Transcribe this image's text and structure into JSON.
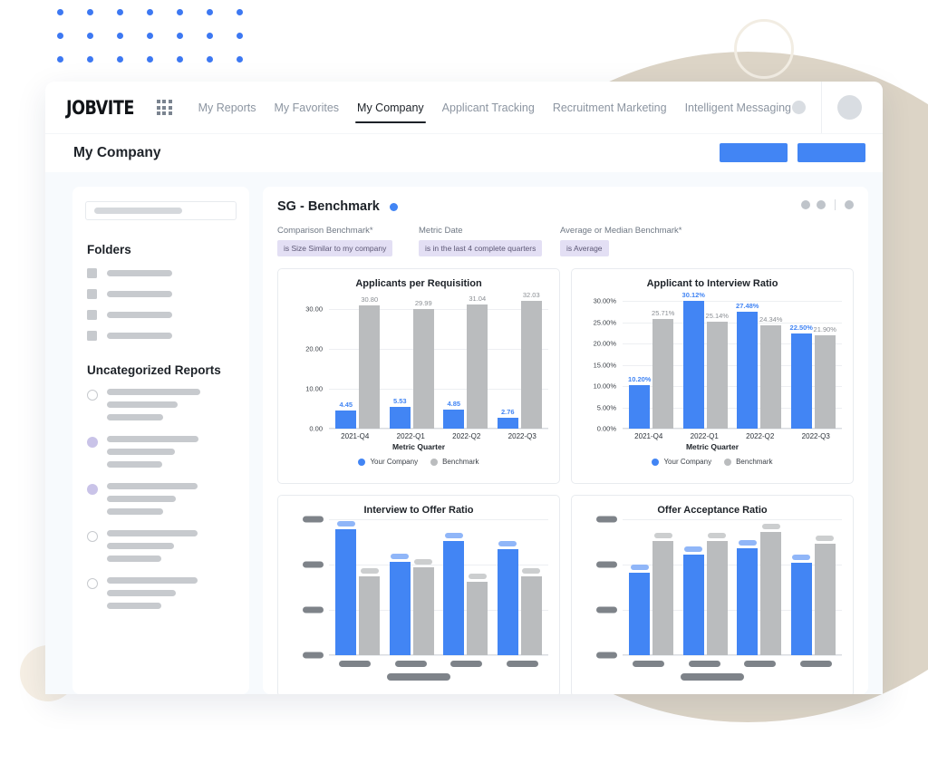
{
  "nav": {
    "logo": "JOBVITE",
    "grid_icon": "apps-grid-icon",
    "links": [
      {
        "label": "My Reports",
        "active": false
      },
      {
        "label": "My Favorites",
        "active": false
      },
      {
        "label": "My Company",
        "active": true
      },
      {
        "label": "Applicant Tracking",
        "active": false
      },
      {
        "label": "Recruitment Marketing",
        "active": false
      },
      {
        "label": "Intelligent Messaging",
        "active": false
      }
    ]
  },
  "page_header": {
    "title": "My Company",
    "buttons": [
      "",
      ""
    ]
  },
  "sidebar": {
    "search_placeholder": "",
    "folders_title": "Folders",
    "folder_widths": [
      72,
      72,
      72,
      72
    ],
    "reports_title": "Uncategorized Reports",
    "reports": [
      {
        "state": "empty",
        "lines": [
          103,
          78,
          62
        ]
      },
      {
        "state": "filled",
        "lines": [
          101,
          75,
          61
        ]
      },
      {
        "state": "filled",
        "lines": [
          100,
          76,
          62
        ]
      },
      {
        "state": "empty",
        "lines": [
          100,
          74,
          60
        ]
      },
      {
        "state": "empty",
        "lines": [
          100,
          76,
          60
        ]
      }
    ]
  },
  "report": {
    "title": "SG - Benchmark",
    "status_dot_color": "#4285F4",
    "controls": [
      "dot",
      "dot",
      "divider",
      "dot"
    ],
    "filters": [
      {
        "label": "Comparison Benchmark*",
        "value": "is Size Similar to my company"
      },
      {
        "label": "Metric Date",
        "value": "is in the last 4 complete quarters"
      },
      {
        "label": "Average or Median Benchmark*",
        "value": "is Average"
      }
    ]
  },
  "legend": {
    "series_1": "Your Company",
    "series_2": "Benchmark"
  },
  "colors": {
    "blue": "#4285F4",
    "gray": "#BABCBE",
    "accent_violet": "#C9C3E8",
    "skeleton": "#C7CACE"
  },
  "chart_data": [
    {
      "type": "bar",
      "title": "Applicants per Requisition",
      "xlabel": "Metric Quarter",
      "ylabel": "",
      "categories": [
        "2021-Q4",
        "2022-Q1",
        "2022-Q2",
        "2022-Q3"
      ],
      "yticks": [
        "0.00",
        "10.00",
        "20.00",
        "30.00"
      ],
      "ylim": [
        0,
        34
      ],
      "grid": true,
      "legend": "bottom",
      "series": [
        {
          "name": "Your Company",
          "color": "#4285F4",
          "values": [
            4.45,
            5.53,
            4.85,
            2.76
          ],
          "labels": [
            "4.45",
            "5.53",
            "4.85",
            "2.76"
          ]
        },
        {
          "name": "Benchmark",
          "color": "#BABCBE",
          "values": [
            30.8,
            29.99,
            31.04,
            32.03
          ],
          "labels": [
            "30.80",
            "29.99",
            "31.04",
            "32.03"
          ]
        }
      ]
    },
    {
      "type": "bar",
      "title": "Applicant to Interview Ratio",
      "xlabel": "Metric Quarter",
      "ylabel": "",
      "categories": [
        "2021-Q4",
        "2022-Q1",
        "2022-Q2",
        "2022-Q3"
      ],
      "yticks": [
        "0.00%",
        "5.00%",
        "10.00%",
        "15.00%",
        "20.00%",
        "25.00%",
        "30.00%"
      ],
      "ylim": [
        0,
        32
      ],
      "grid": true,
      "legend": "bottom",
      "series": [
        {
          "name": "Your Company",
          "color": "#4285F4",
          "values": [
            10.2,
            30.12,
            27.48,
            22.5
          ],
          "labels": [
            "10.20%",
            "30.12%",
            "27.48%",
            "22.50%"
          ]
        },
        {
          "name": "Benchmark",
          "color": "#BABCBE",
          "values": [
            25.71,
            25.14,
            24.34,
            21.9
          ],
          "labels": [
            "25.71%",
            "25.14%",
            "24.34%",
            "21.90%"
          ]
        }
      ]
    },
    {
      "type": "bar",
      "title": "Interview to Offer Ratio",
      "xlabel": "",
      "ylabel": "",
      "categories": [
        "",
        "",
        "",
        ""
      ],
      "yticks": [
        "",
        "",
        "",
        ""
      ],
      "ylim": [
        0,
        100
      ],
      "grid": true,
      "legend": "none",
      "loading": true,
      "series": [
        {
          "name": "Your Company",
          "color": "#4285F4",
          "values": [
            93,
            69,
            84,
            78
          ]
        },
        {
          "name": "Benchmark",
          "color": "#BABCBE",
          "values": [
            58,
            65,
            54,
            58
          ]
        }
      ]
    },
    {
      "type": "bar",
      "title": "Offer Acceptance Ratio",
      "xlabel": "",
      "ylabel": "",
      "categories": [
        "",
        "",
        "",
        ""
      ],
      "yticks": [
        "",
        "",
        "",
        ""
      ],
      "ylim": [
        0,
        100
      ],
      "grid": true,
      "legend": "none",
      "loading": true,
      "series": [
        {
          "name": "Your Company",
          "color": "#4285F4",
          "values": [
            61,
            74,
            79,
            68
          ]
        },
        {
          "name": "Benchmark",
          "color": "#BABCBE",
          "values": [
            84,
            84,
            91,
            82
          ]
        }
      ]
    }
  ]
}
